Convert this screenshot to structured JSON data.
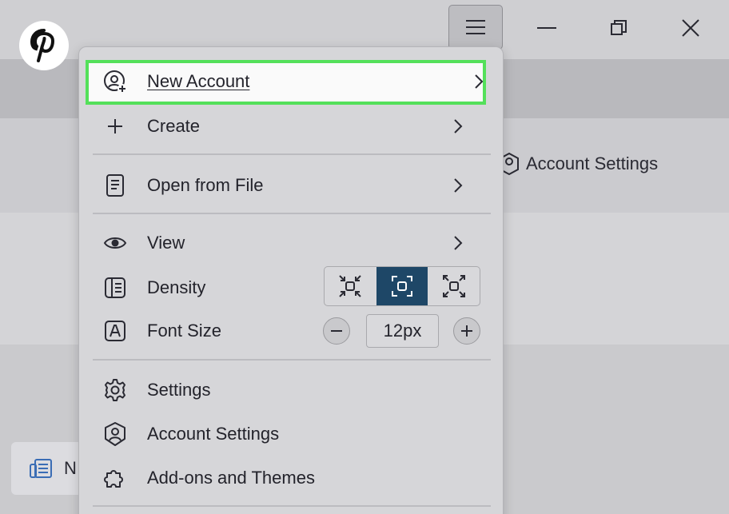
{
  "menu": {
    "items": [
      {
        "label": "New Account",
        "icon": "account-add-icon"
      },
      {
        "label": "Create",
        "icon": "plus-icon"
      },
      {
        "label": "Open from File",
        "icon": "file-icon"
      },
      {
        "label": "View",
        "icon": "eye-icon"
      },
      {
        "label": "Density",
        "icon": "list-icon"
      },
      {
        "label": "Font Size",
        "icon": "font-icon"
      },
      {
        "label": "Settings",
        "icon": "gear-icon"
      },
      {
        "label": "Account Settings",
        "icon": "account-settings-icon"
      },
      {
        "label": "Add-ons and Themes",
        "icon": "puzzle-icon"
      }
    ],
    "font_size_value": "12px",
    "density_options": [
      "compact",
      "normal",
      "touch"
    ],
    "density_selected": "normal"
  },
  "background": {
    "account_settings_label": "Account Settings",
    "card_label": "N"
  },
  "colors": {
    "highlight_border": "#54e05a",
    "density_active": "#1e4767",
    "pinterest_red": "#000000"
  }
}
